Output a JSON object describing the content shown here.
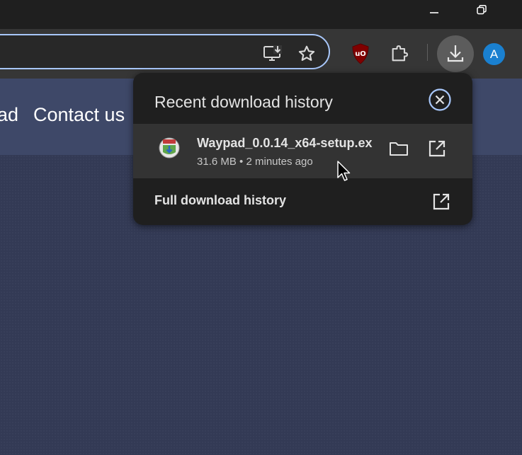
{
  "window": {
    "minimize_icon": "minimize-icon",
    "restore_icon": "restore-icon"
  },
  "toolbar": {
    "icons": [
      "install-app-icon",
      "bookmark-star-icon",
      "ublock-origin-icon",
      "extensions-puzzle-icon",
      "download-icon"
    ],
    "avatar_initial": "A",
    "accent_color": "#a8c7fa"
  },
  "page": {
    "nav": {
      "partial_link": "ad",
      "contact_link": "Contact us"
    }
  },
  "download_popup": {
    "title": "Recent download history",
    "close_icon": "close-circle-icon",
    "item": {
      "file_name": "Waypad_0.0.14_x64-setup.ex",
      "size": "31.6 MB",
      "separator": "•",
      "time": "2 minutes ago",
      "show_in_folder_icon": "folder-icon",
      "open_icon": "open-external-icon"
    },
    "full_history_label": "Full download history",
    "full_history_icon": "open-external-icon"
  }
}
